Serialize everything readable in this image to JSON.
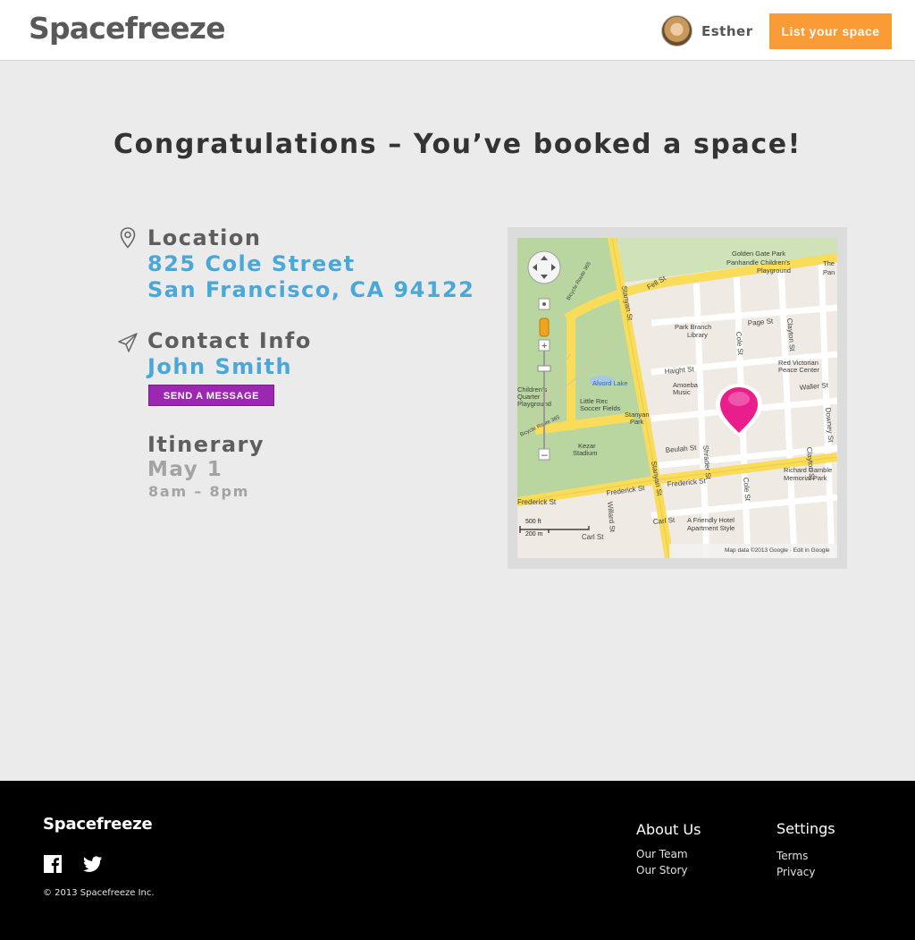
{
  "header": {
    "logo": "Spacefreeze",
    "user_name": "Esther",
    "list_space_label": "List your space"
  },
  "main": {
    "title": "Congratulations – You’ve booked a space!",
    "location": {
      "label": "Location",
      "address_line1": "825 Cole Street",
      "address_line2": "San Francisco, CA 94122"
    },
    "contact": {
      "label": "Contact Info",
      "name": "John Smith",
      "message_button": "SEND A MESSAGE"
    },
    "itinerary": {
      "label": "Itinerary",
      "date": "May 1",
      "time": "8am – 8pm"
    }
  },
  "map": {
    "streets": {
      "fell": "Fell St",
      "stanyan": "Stanyan St",
      "stanyan2": "Stanyan St",
      "page": "Page St",
      "haight": "Haight St",
      "waller": "Waller St",
      "frederick": "Frederick St",
      "frederick2": "Frederick St",
      "frederick3": "Frederick St",
      "beulah": "Beulah St",
      "carl": "Carl St",
      "carl2": "Carl St",
      "cole": "Cole St",
      "cole2": "Cole St",
      "clayton": "Clayton St",
      "clayton2": "Clayton St",
      "shrader": "Shrader St",
      "downey": "Downey St",
      "willard": "Willard St",
      "bicycle_route": "Bicycle Route 365",
      "bicycle_route2": "Bicycle Route 365"
    },
    "places": {
      "golden_gate_park": "Golden Gate Park",
      "panhandle_playground": "Panhandle Children’s",
      "playground": "Playground",
      "the": "The",
      "pan": "Pan",
      "park_branch": "Park Branch",
      "library": "Library",
      "red_victorian": "Red Victorian",
      "peace_center": "Peace Center",
      "alvord_lake": "Alvord Lake",
      "childrens": "Children’s",
      "quarter": "Quarter",
      "playground2": "Playground",
      "little_rec": "Little Rec",
      "soccer_fields": "Soccer Fields",
      "stanyan_park": "Stanyan",
      "park": "Park",
      "kezar": "Kezar",
      "stadium": "Stadium",
      "amoeba": "Amoeba",
      "music": "Music",
      "richard_gamble": "Richard Gamble",
      "memorial_park": "Memorial Park",
      "hotel": "A Friendly Hotel",
      "apartment_style": "Apartment Style"
    },
    "scale_ft": "500 ft",
    "scale_m": "200 m",
    "attribution": "Map data ©2013 Google · Edit in Google"
  },
  "footer": {
    "logo": "Spacefreeze",
    "copyright": "© 2013  Spacefreeze Inc.",
    "about": {
      "heading": "About Us",
      "links": [
        "Our Team",
        "Our Story"
      ]
    },
    "settings": {
      "heading": "Settings",
      "links": [
        "Terms",
        "Privacy"
      ]
    }
  },
  "colors": {
    "accent_orange": "#fa9b35",
    "link_blue": "#4aa8d8",
    "message_purple": "#9c27b0",
    "map_road": "#f8dc5a",
    "map_park": "#b9d6a0",
    "pin_pink": "#e91e8c"
  },
  "icons": {
    "location": "map-pin-outline-icon",
    "contact": "paper-plane-icon",
    "facebook": "facebook-icon",
    "twitter": "twitter-icon",
    "map_pin": "map-marker-icon"
  }
}
